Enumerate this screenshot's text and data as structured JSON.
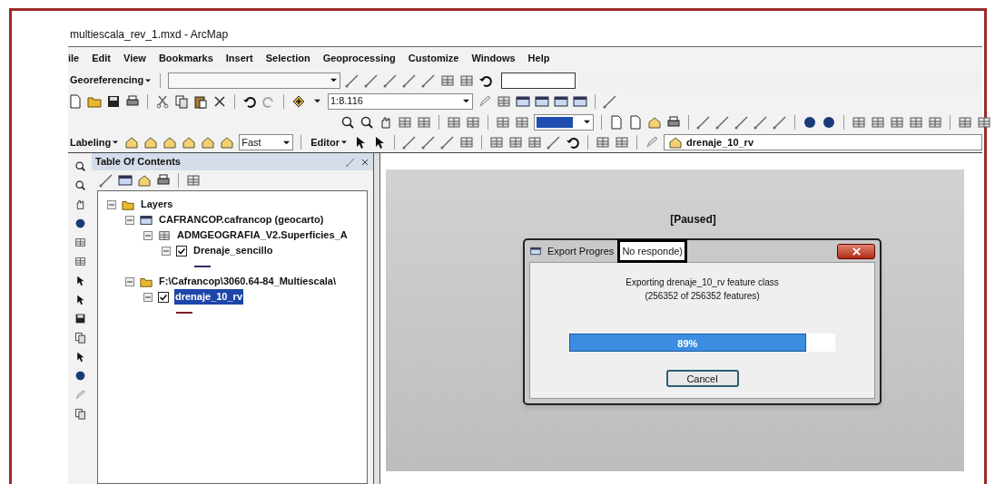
{
  "window": {
    "title": "multiescala_rev_1.mxd - ArcMap"
  },
  "menu": [
    "ile",
    "Edit",
    "View",
    "Bookmarks",
    "Insert",
    "Selection",
    "Geoprocessing",
    "Customize",
    "Windows",
    "Help"
  ],
  "toolbars": {
    "georeferencing": "Georeferencing",
    "scale": "1:8.116",
    "labeling": "Labeling",
    "label_quality": "Fast",
    "editor": "Editor",
    "target_layer": "drenaje_10_rv"
  },
  "toc": {
    "title": "Table Of Contents",
    "tree": [
      {
        "label": "Layers",
        "kind": "frame",
        "expanded": true,
        "children": [
          {
            "label": "CAFRANCOP.cafrancop (geocarto)",
            "kind": "database",
            "expanded": true,
            "children": [
              {
                "label": "ADMGEOGRAFIA_V2.Superficies_A",
                "kind": "dataset",
                "expanded": true,
                "children": [
                  {
                    "label": "Drenaje_sencillo",
                    "kind": "layer",
                    "expanded": true,
                    "checked": true,
                    "selected": false,
                    "color": "#3b2466"
                  }
                ]
              }
            ]
          },
          {
            "label": "F:\\Cafrancop\\3060.64-84_Multiescala\\",
            "kind": "folder",
            "expanded": true,
            "children": [
              {
                "label": "drenaje_10_rv",
                "kind": "layer",
                "expanded": true,
                "checked": true,
                "selected": true,
                "color": "#7a1f2a"
              }
            ]
          }
        ]
      }
    ]
  },
  "map": {
    "status": "[Paused]"
  },
  "dialog": {
    "title": "Export Progres",
    "annotation": "No responde)",
    "message": "Exporting drenaje_10_rv feature class",
    "count": "(256352 of 256352 features)",
    "progress": {
      "level": 0.89,
      "reading": "89%"
    },
    "buttons": [
      "Cancel"
    ]
  }
}
